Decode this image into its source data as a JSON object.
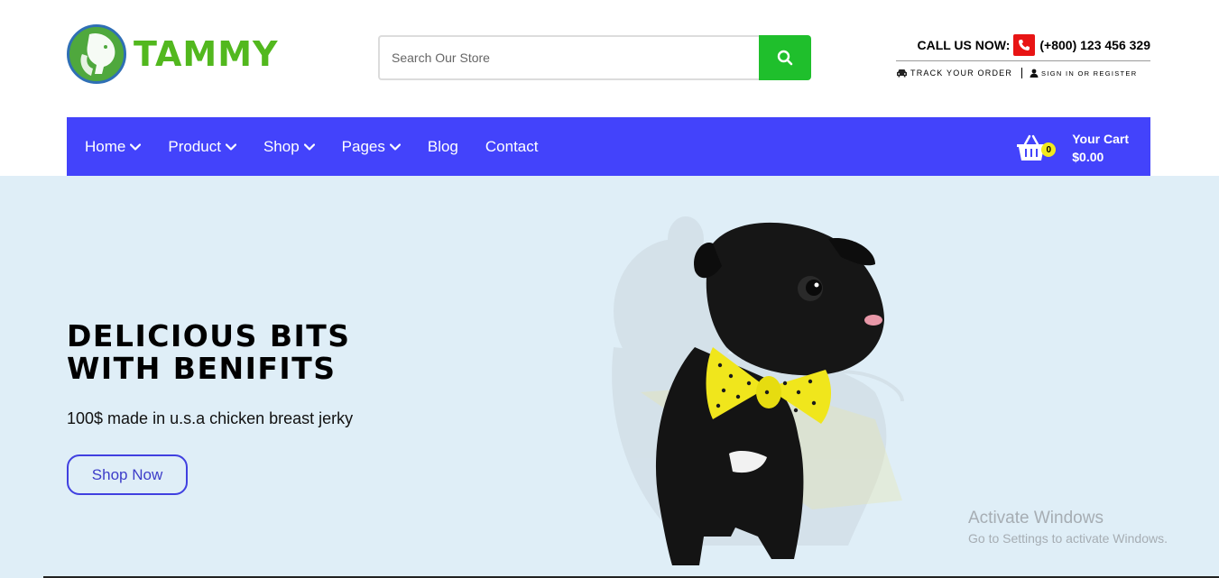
{
  "brand": {
    "name": "TAMMY",
    "logo_icon": "dog-cat-icon",
    "color": "#52b81e"
  },
  "search": {
    "placeholder": "Search Our Store",
    "button_icon": "search-icon",
    "button_color": "#1fbf2c"
  },
  "contact": {
    "call_label": "CALL US NOW:",
    "phone": "(+800) 123 456 329",
    "track_label": "TRACK YOUR ORDER",
    "signin_label": "SIGN IN OR REGISTER"
  },
  "nav": {
    "background": "#4343fb",
    "items": [
      {
        "label": "Home",
        "has_dropdown": true
      },
      {
        "label": "Product",
        "has_dropdown": true
      },
      {
        "label": "Shop",
        "has_dropdown": true
      },
      {
        "label": "Pages",
        "has_dropdown": true
      },
      {
        "label": "Blog",
        "has_dropdown": false
      },
      {
        "label": "Contact",
        "has_dropdown": false
      }
    ]
  },
  "cart": {
    "count": "0",
    "label": "Your Cart",
    "total": "$0.00"
  },
  "hero": {
    "title_line1": "DELICIOUS BITS",
    "title_line2": "WITH BENIFITS",
    "subtitle": "100$ made in u.s.a chicken breast jerky",
    "cta": "Shop Now",
    "background": "#dfeef7"
  },
  "watermark": {
    "title": "Activate Windows",
    "subtitle": "Go to Settings to activate Windows."
  }
}
